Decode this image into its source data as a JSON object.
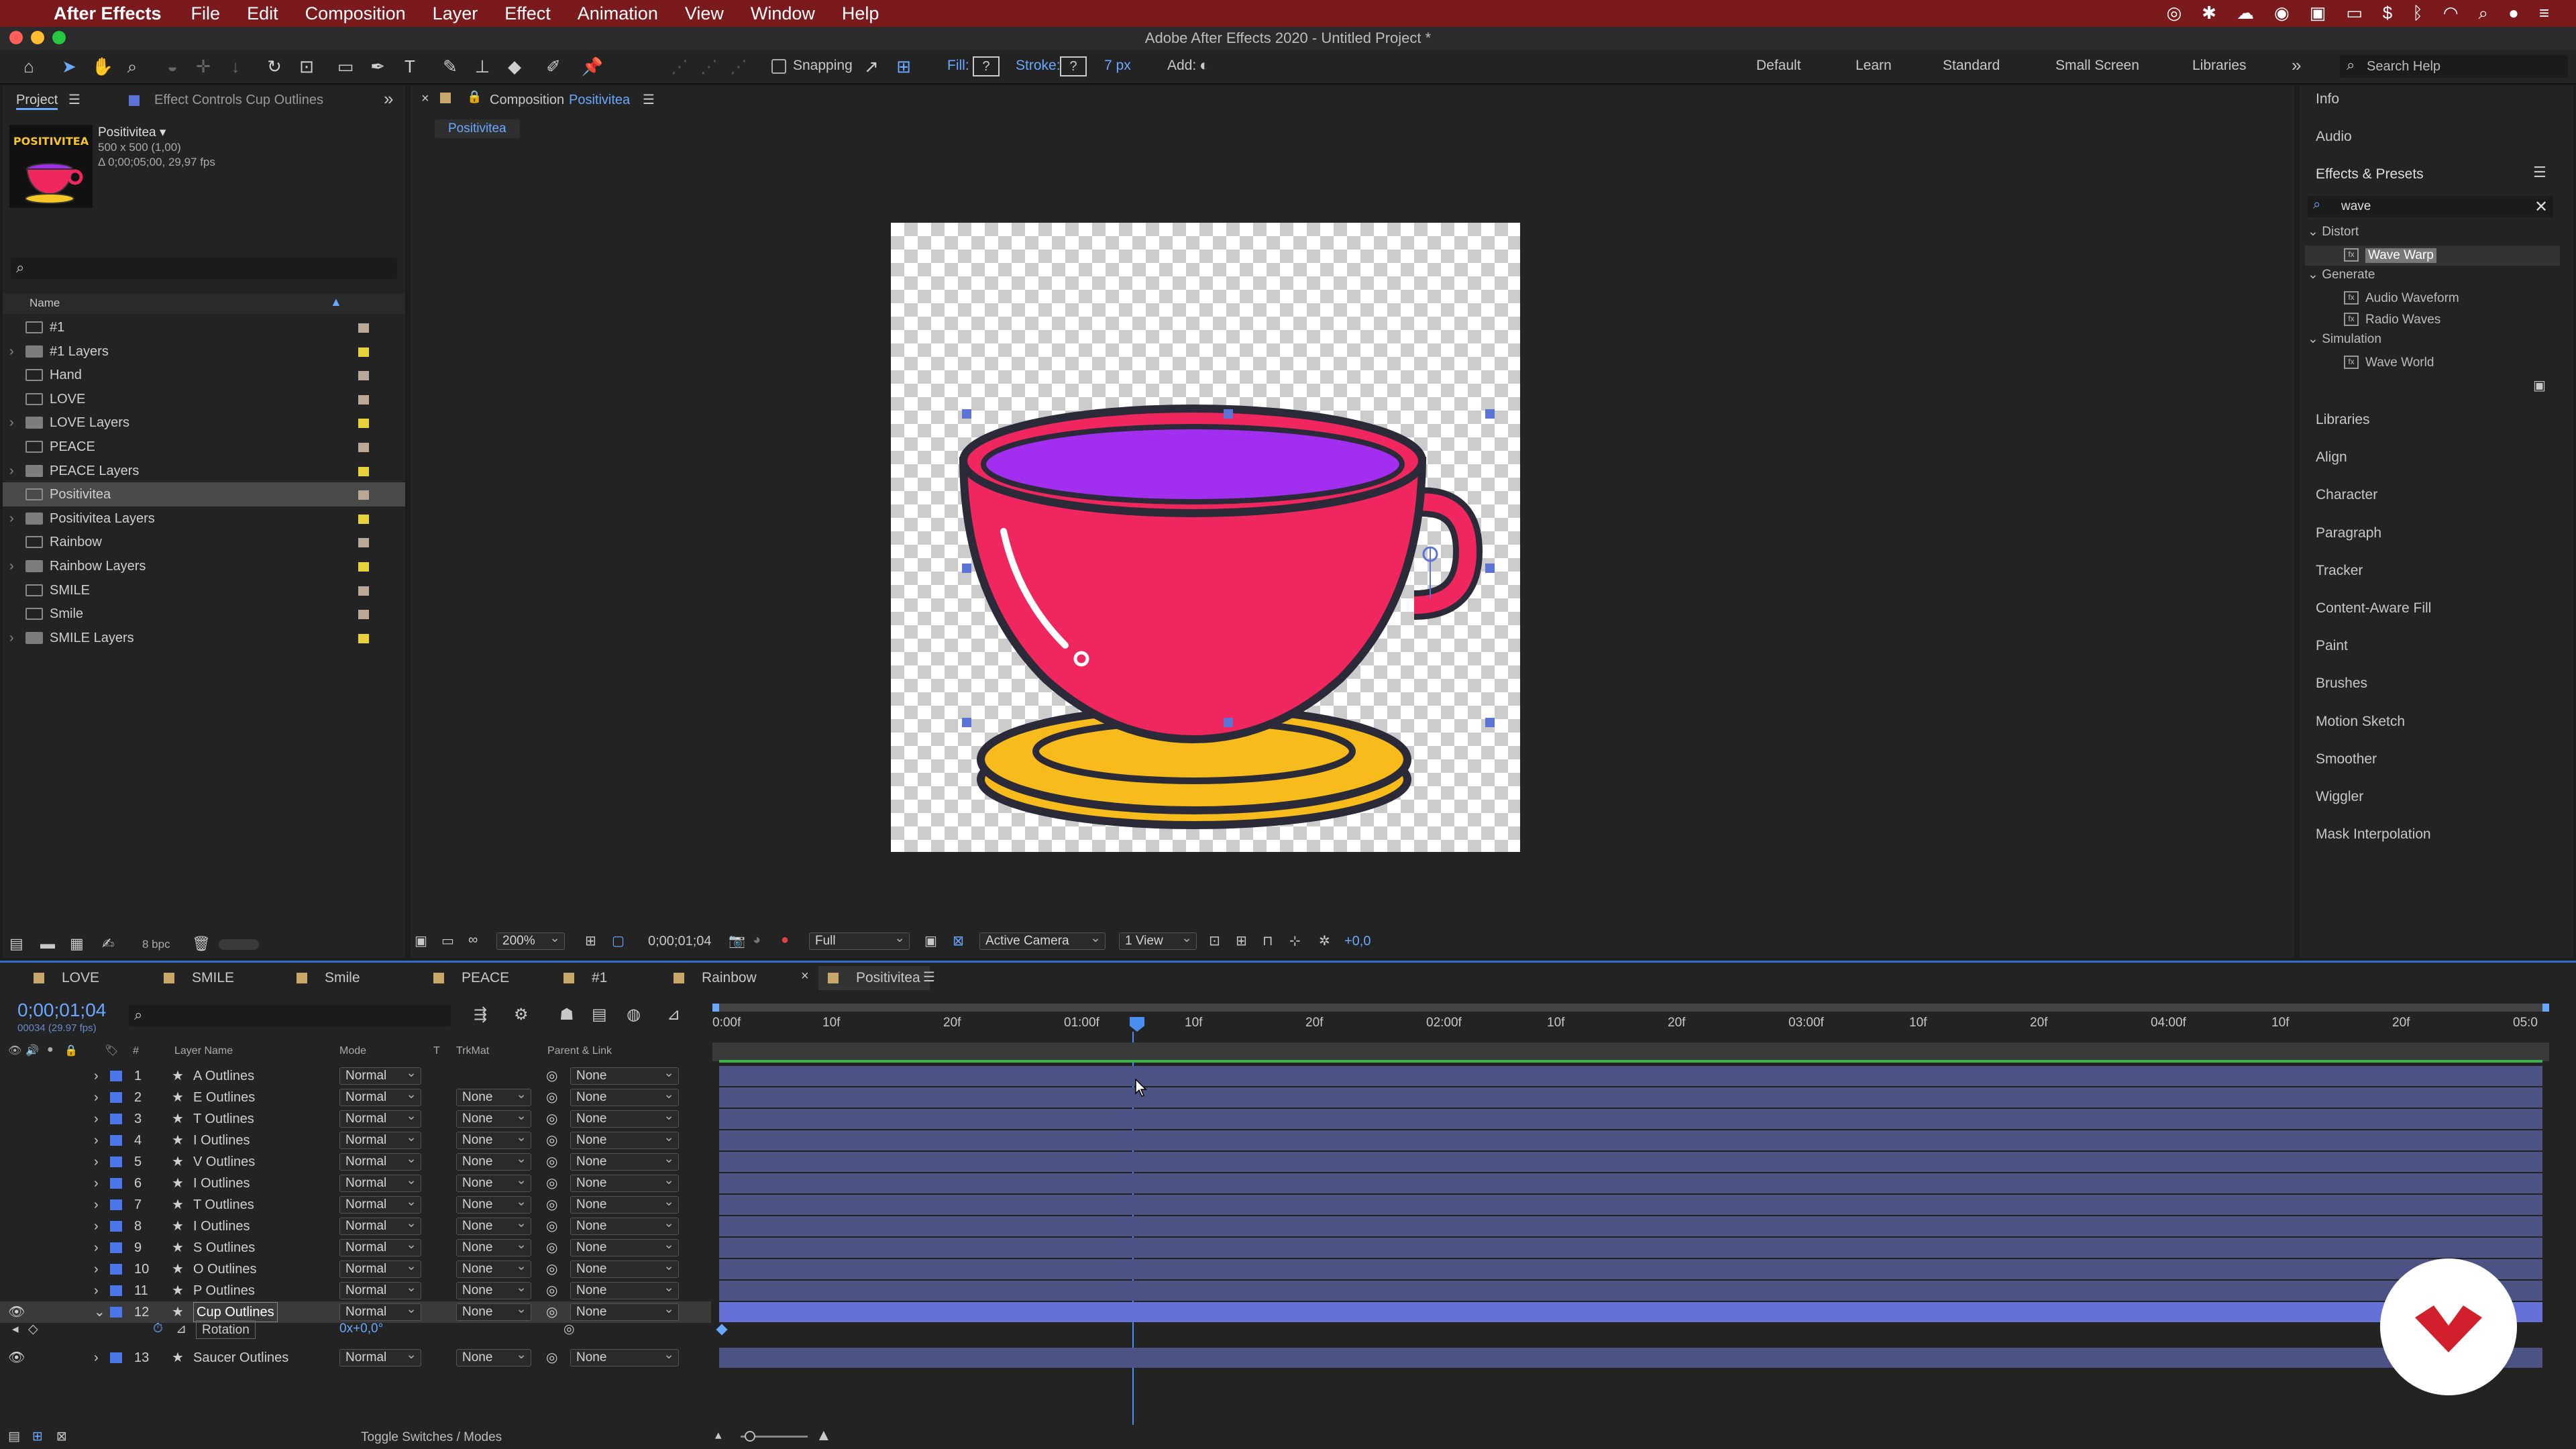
{
  "menubar": {
    "app_name": "After Effects",
    "items": [
      "File",
      "Edit",
      "Composition",
      "Layer",
      "Effect",
      "Animation",
      "View",
      "Window",
      "Help"
    ]
  },
  "window_title": "Adobe After Effects 2020 - Untitled Project *",
  "toolbar": {
    "snapping_label": "Snapping",
    "fill_label": "Fill:",
    "stroke_label": "Stroke:",
    "stroke_width": "7 px",
    "add_label": "Add:",
    "workspaces": [
      "Default",
      "Learn",
      "Standard",
      "Small Screen",
      "Libraries"
    ],
    "search_placeholder": "Search Help"
  },
  "project_panel": {
    "tab_project": "Project",
    "tab_effect_controls": "Effect Controls Cup Outlines",
    "selected_name": "Positivitea ▾",
    "selected_size": "500 x 500 (1,00)",
    "selected_duration": "Δ 0;00;05;00, 29,97 fps",
    "name_col": "Name",
    "items": [
      {
        "name": "#1",
        "type": "comp",
        "label_color": "#b8a898"
      },
      {
        "name": "#1 Layers",
        "type": "folder",
        "label_color": "#e8d23a"
      },
      {
        "name": "Hand",
        "type": "comp",
        "label_color": "#b8a898"
      },
      {
        "name": "LOVE",
        "type": "comp",
        "label_color": "#b8a898"
      },
      {
        "name": "LOVE Layers",
        "type": "folder",
        "label_color": "#e8d23a"
      },
      {
        "name": "PEACE",
        "type": "comp",
        "label_color": "#b8a898"
      },
      {
        "name": "PEACE Layers",
        "type": "folder",
        "label_color": "#e8d23a"
      },
      {
        "name": "Positivitea",
        "type": "comp",
        "label_color": "#b8a898",
        "selected": true
      },
      {
        "name": "Positivitea Layers",
        "type": "folder",
        "label_color": "#e8d23a"
      },
      {
        "name": "Rainbow",
        "type": "comp",
        "label_color": "#b8a898"
      },
      {
        "name": "Rainbow Layers",
        "type": "folder",
        "label_color": "#e8d23a"
      },
      {
        "name": "SMILE",
        "type": "comp",
        "label_color": "#b8a898"
      },
      {
        "name": "Smile",
        "type": "comp",
        "label_color": "#b8a898"
      },
      {
        "name": "SMILE Layers",
        "type": "folder",
        "label_color": "#e8d23a"
      }
    ],
    "bpc": "8 bpc"
  },
  "composition_panel": {
    "tab_label": "Composition",
    "comp_name": "Positivitea",
    "breadcrumb": "Positivitea",
    "zoom": "200%",
    "timecode": "0;00;01;04",
    "resolution": "Full",
    "camera": "Active Camera",
    "views": "1 View",
    "exposure": "+0,0"
  },
  "right_panel": {
    "info": "Info",
    "audio": "Audio",
    "effects_presets": "Effects & Presets",
    "search_value": "wave",
    "tree": [
      {
        "category": "Distort",
        "items": [
          "Wave Warp"
        ]
      },
      {
        "category": "Generate",
        "items": [
          "Audio Waveform",
          "Radio Waves"
        ]
      },
      {
        "category": "Simulation",
        "items": [
          "Wave World"
        ]
      }
    ],
    "panels": [
      "Libraries",
      "Align",
      "Character",
      "Paragraph",
      "Tracker",
      "Content-Aware Fill",
      "Paint",
      "Brushes",
      "Motion Sketch",
      "Smoother",
      "Wiggler",
      "Mask Interpolation"
    ]
  },
  "timeline": {
    "tabs": [
      "LOVE",
      "SMILE",
      "Smile",
      "PEACE",
      "#1",
      "Rainbow",
      "Positivitea"
    ],
    "current_time": "0;00;01;04",
    "frame_info": "00034 (29.97 fps)",
    "col_layer_name": "Layer Name",
    "col_mode": "Mode",
    "col_t": "T",
    "col_trkmat": "TrkMat",
    "col_parent": "Parent & Link",
    "ruler": [
      "0:00f",
      "10f",
      "20f",
      "01:00f",
      "10f",
      "20f",
      "02:00f",
      "10f",
      "20f",
      "03:00f",
      "10f",
      "20f",
      "04:00f",
      "10f",
      "20f",
      "05:0"
    ],
    "layers": [
      {
        "num": "1",
        "name": "A Outlines",
        "mode": "Normal",
        "trkmat": "",
        "parent": "None"
      },
      {
        "num": "2",
        "name": "E Outlines",
        "mode": "Normal",
        "trkmat": "None",
        "parent": "None"
      },
      {
        "num": "3",
        "name": "T Outlines",
        "mode": "Normal",
        "trkmat": "None",
        "parent": "None"
      },
      {
        "num": "4",
        "name": "I Outlines",
        "mode": "Normal",
        "trkmat": "None",
        "parent": "None"
      },
      {
        "num": "5",
        "name": "V Outlines",
        "mode": "Normal",
        "trkmat": "None",
        "parent": "None"
      },
      {
        "num": "6",
        "name": "I Outlines",
        "mode": "Normal",
        "trkmat": "None",
        "parent": "None"
      },
      {
        "num": "7",
        "name": "T Outlines",
        "mode": "Normal",
        "trkmat": "None",
        "parent": "None"
      },
      {
        "num": "8",
        "name": "I Outlines",
        "mode": "Normal",
        "trkmat": "None",
        "parent": "None"
      },
      {
        "num": "9",
        "name": "S Outlines",
        "mode": "Normal",
        "trkmat": "None",
        "parent": "None"
      },
      {
        "num": "10",
        "name": "O Outlines",
        "mode": "Normal",
        "trkmat": "None",
        "parent": "None"
      },
      {
        "num": "11",
        "name": "P Outlines",
        "mode": "Normal",
        "trkmat": "None",
        "parent": "None"
      },
      {
        "num": "12",
        "name": "Cup Outlines",
        "mode": "Normal",
        "trkmat": "None",
        "parent": "None",
        "selected": true
      },
      {
        "num": "13",
        "name": "Saucer Outlines",
        "mode": "Normal",
        "trkmat": "None",
        "parent": "None"
      }
    ],
    "property_name": "Rotation",
    "property_value": "0x+0,0°",
    "toggle_label": "Toggle Switches / Modes"
  }
}
